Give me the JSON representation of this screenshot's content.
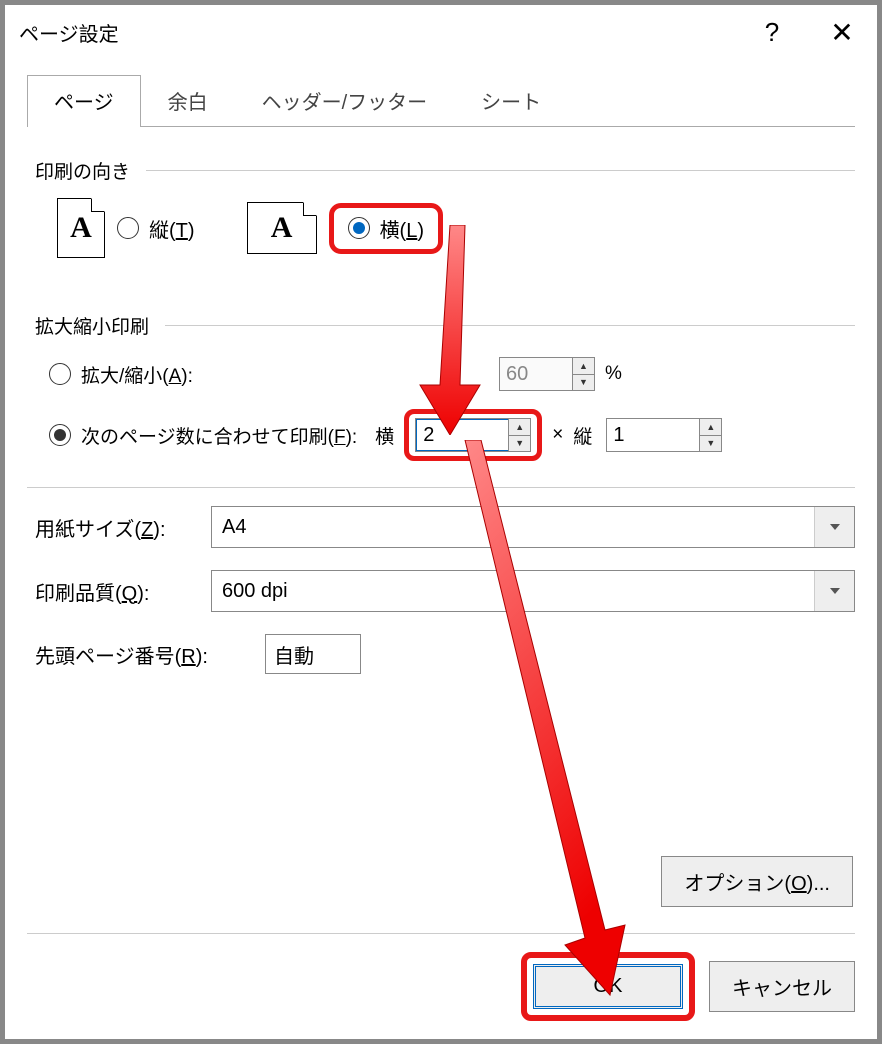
{
  "titlebar": {
    "title": "ページ設定"
  },
  "tabs": {
    "page": "ページ",
    "margins": "余白",
    "headerfooter": "ヘッダー/フッター",
    "sheet": "シート"
  },
  "orientation": {
    "section": "印刷の向き",
    "portrait_pre": "縦(",
    "portrait_key": "T",
    "portrait_post": ")",
    "landscape_pre": "横(",
    "landscape_key": "L",
    "landscape_post": ")",
    "icon_letter": "A"
  },
  "scaling": {
    "section": "拡大縮小印刷",
    "adjust_pre": "拡大/縮小(",
    "adjust_key": "A",
    "adjust_post": "):",
    "adjust_value": "60",
    "percent": "%",
    "fit_pre": "次のページ数に合わせて印刷(",
    "fit_key": "F",
    "fit_post": "):",
    "wide_label": "横",
    "wide_value": "2",
    "times": "×",
    "tall_label": "縦",
    "tall_value": "1"
  },
  "paper": {
    "size_pre": "用紙サイズ(",
    "size_key": "Z",
    "size_post": "):",
    "size_value": "A4",
    "quality_pre": "印刷品質(",
    "quality_key": "Q",
    "quality_post": "):",
    "quality_value": "600 dpi",
    "firstpage_pre": "先頭ページ番号(",
    "firstpage_key": "R",
    "firstpage_post": "):",
    "firstpage_value": "自動"
  },
  "buttons": {
    "options_pre": "オプション(",
    "options_key": "O",
    "options_post": ")...",
    "ok": "OK",
    "cancel": "キャンセル"
  }
}
